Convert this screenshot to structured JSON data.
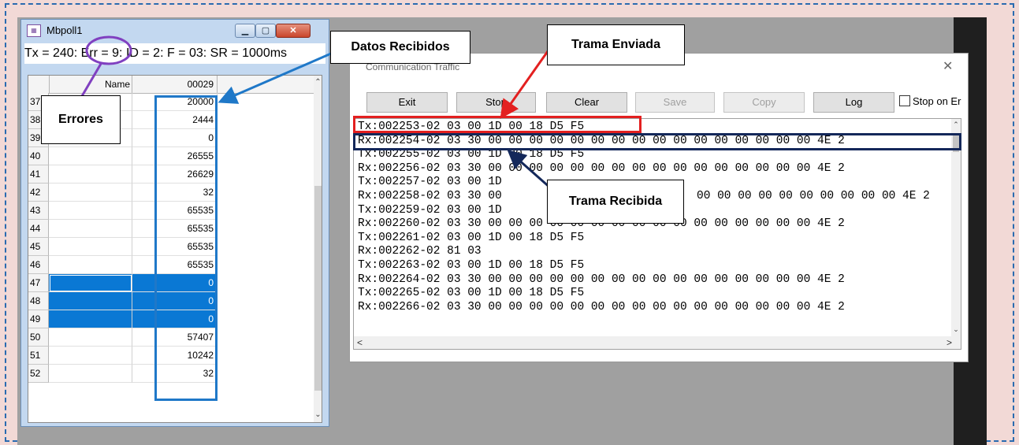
{
  "mbpoll": {
    "title": "Mbpoll1",
    "app_icon": "app-icon",
    "window_buttons": [
      "minimize-icon",
      "maximize-icon",
      "close-icon"
    ],
    "status_line": "Tx = 240: Err = 9: ID = 2: F = 03: SR = 1000ms",
    "grid": {
      "header_name": "Name",
      "header_value": "00029",
      "rows": [
        {
          "n": "37",
          "value": "20000",
          "selected": false
        },
        {
          "n": "38",
          "value": "2444",
          "selected": false
        },
        {
          "n": "39",
          "value": "0",
          "selected": false
        },
        {
          "n": "40",
          "value": "26555",
          "selected": false
        },
        {
          "n": "41",
          "value": "26629",
          "selected": false
        },
        {
          "n": "42",
          "value": "32",
          "selected": false
        },
        {
          "n": "43",
          "value": "65535",
          "selected": false
        },
        {
          "n": "44",
          "value": "65535",
          "selected": false
        },
        {
          "n": "45",
          "value": "65535",
          "selected": false
        },
        {
          "n": "46",
          "value": "65535",
          "selected": false
        },
        {
          "n": "47",
          "value": "0",
          "selected": true
        },
        {
          "n": "48",
          "value": "0",
          "selected": true
        },
        {
          "n": "49",
          "value": "0",
          "selected": true
        },
        {
          "n": "50",
          "value": "57407",
          "selected": false
        },
        {
          "n": "51",
          "value": "10242",
          "selected": false
        },
        {
          "n": "52",
          "value": "32",
          "selected": false
        }
      ]
    }
  },
  "traffic": {
    "title": "Communication Traffic",
    "buttons": {
      "exit": "Exit",
      "stop": "Stop",
      "clear": "Clear",
      "save": "Save",
      "copy": "Copy",
      "log": "Log"
    },
    "stop_on_error": "Stop on Er",
    "lines": [
      "Tx:002253-02 03 00 1D 00 18 D5 F5",
      "Rx:002254-02 03 30 00 00 00 00 00 00 00 00 00 00 00 00 00 00 00 00 4E 2",
      "Tx:002255-02 03 00 1D 00 18 D5 F5",
      "Rx:002256-02 03 30 00 00 00 00 00 00 00 00 00 00 00 00 00 00 00 00 4E 2",
      "Tx:002257-02 03 00 1D",
      "Rx:002258-02 03 30 00",
      "Tx:002259-02 03 00 1D",
      "Rx:002260-02 03 30 00 00 00 00 00 00 00 00 00 00 00 00 00 00 00 00 4E 2",
      "Tx:002261-02 03 00 1D 00 18 D5 F5",
      "Rx:002262-02 81 03",
      "Tx:002263-02 03 00 1D 00 18 D5 F5",
      "Rx:002264-02 03 30 00 00 00 00 00 00 00 00 00 00 00 00 00 00 00 00 4E 2",
      "Tx:002265-02 03 00 1D 00 18 D5 F5",
      "Rx:002266-02 03 30 00 00 00 00 00 00 00 00 00 00 00 00 00 00 00 00 4E 2"
    ],
    "line_tail_after_overlay": "00 00 00 00 00 00 00 00 00 00 4E 2"
  },
  "annotations": {
    "datos_recibidos": "Datos Recibidos",
    "trama_enviada": "Trama Enviada",
    "errores": "Errores",
    "trama_recibida": "Trama Recibida"
  },
  "colors": {
    "accent_blue": "#1f78c8",
    "accent_red": "#e32020",
    "accent_purple": "#8040c0",
    "accent_navy": "#14285a",
    "selection": "#0a78d4",
    "page_bg": "#f2d9d6",
    "dashed_border": "#2a6bb0"
  }
}
